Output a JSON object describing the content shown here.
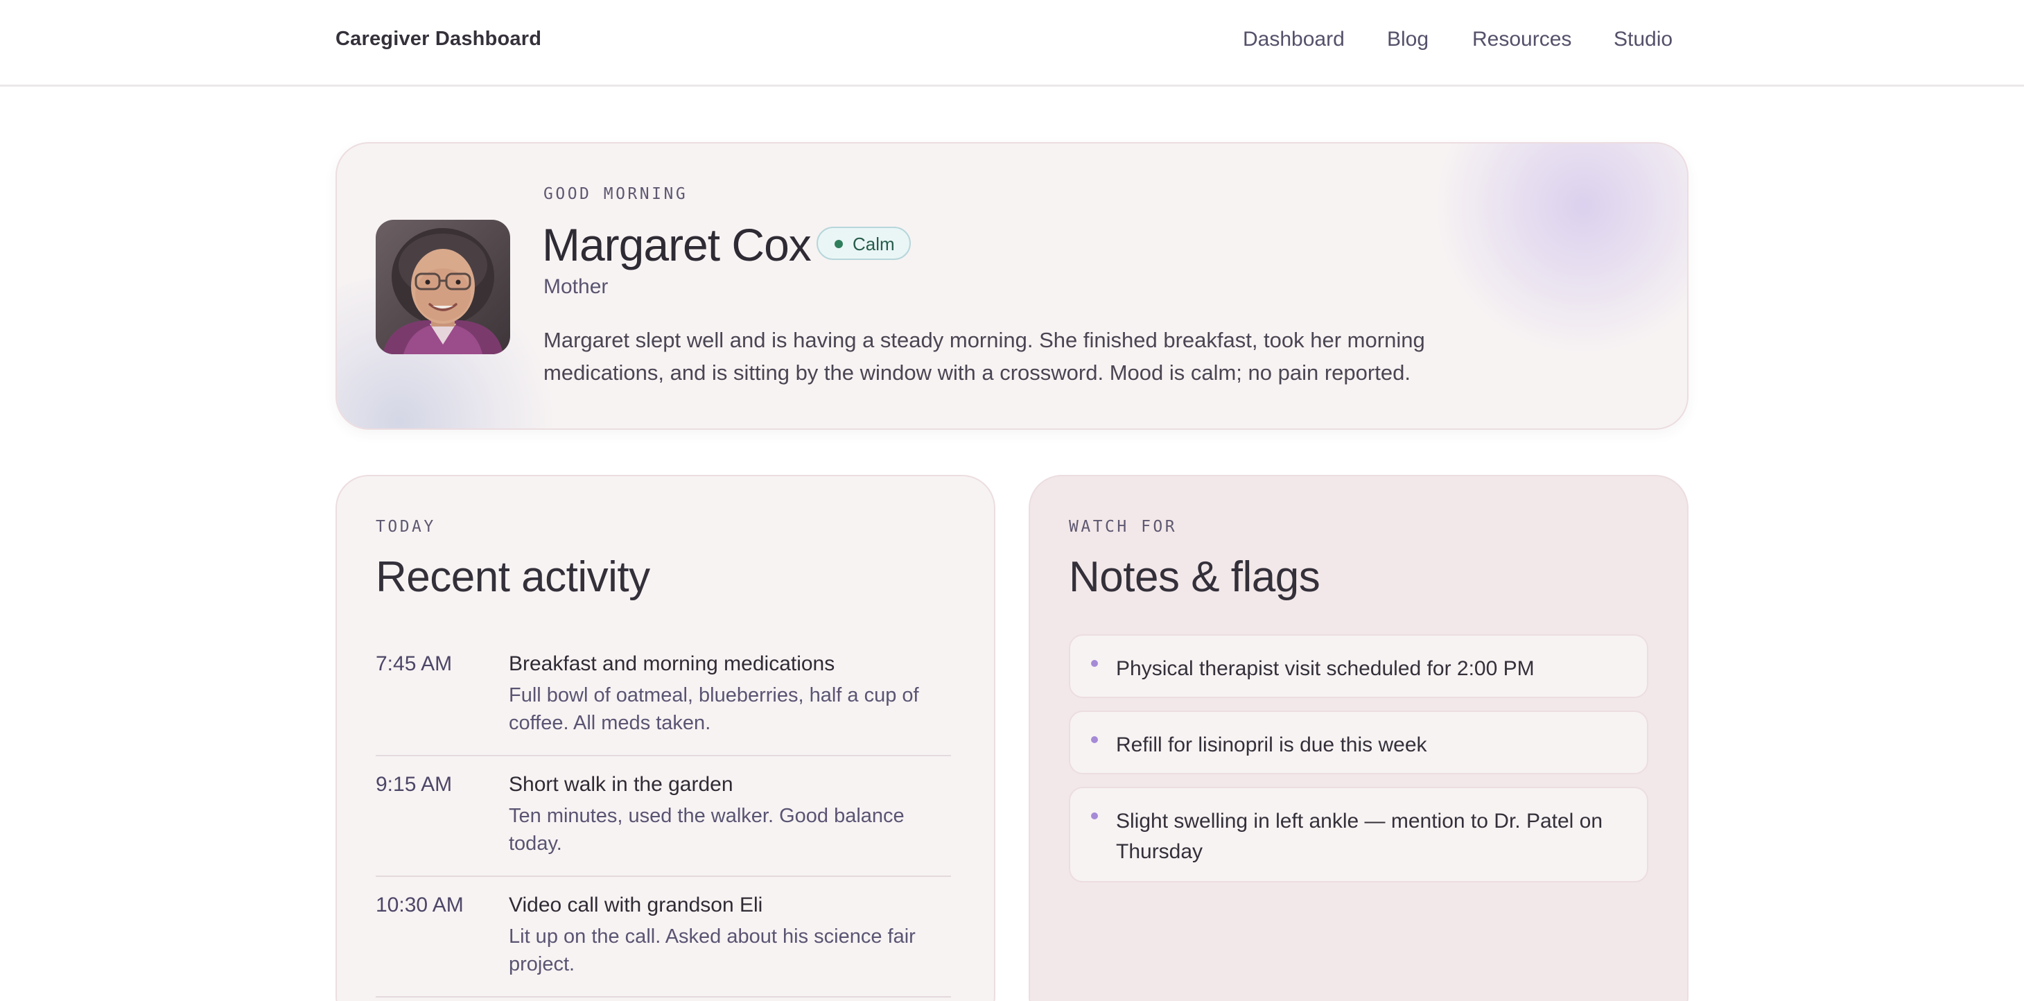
{
  "header": {
    "brand": "Caregiver Dashboard",
    "nav": [
      "Dashboard",
      "Blog",
      "Resources",
      "Studio"
    ]
  },
  "hero": {
    "greeting": "GOOD MORNING",
    "name": "Margaret Cox",
    "relation": "Mother",
    "mood_badge": "Calm",
    "summary": "Margaret slept well and is having a steady morning. She finished breakfast, took her morning medications, and is sitting by the window with a crossword. Mood is calm; no pain reported."
  },
  "activity": {
    "eyebrow": "TODAY",
    "title": "Recent activity",
    "items": [
      {
        "time": "7:45 AM",
        "title": "Breakfast and morning medications",
        "desc": "Full bowl of oatmeal, blueberries, half a cup of coffee. All meds taken."
      },
      {
        "time": "9:15 AM",
        "title": "Short walk in the garden",
        "desc": "Ten minutes, used the walker. Good balance today."
      },
      {
        "time": "10:30 AM",
        "title": "Video call with grandson Eli",
        "desc": "Lit up on the call. Asked about his science fair project."
      }
    ]
  },
  "notes": {
    "eyebrow": "WATCH FOR",
    "title": "Notes & flags",
    "items": [
      "Physical therapist visit scheduled for 2:00 PM",
      "Refill for lisinopril is due this week",
      "Slight swelling in left ankle — mention to Dr. Patel on Thursday"
    ]
  },
  "colors": {
    "accent_purple": "#a58ad6",
    "badge_green": "#2f7f5c",
    "card_bg": "#f7f3f3",
    "flags_panel_bg": "#f2e8e9"
  }
}
